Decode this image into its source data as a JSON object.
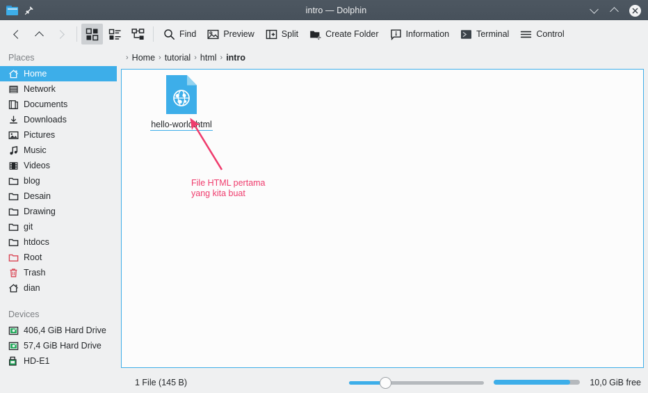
{
  "window": {
    "title": "intro — Dolphin",
    "folder_icon": "folder-icon",
    "pin_icon": "pin-icon",
    "minimize_icon": "chevron-down-icon",
    "maximize_icon": "chevron-up-icon",
    "close_icon": "close-icon"
  },
  "toolbar": {
    "back_icon": "back-arrow-icon",
    "up_icon": "up-arrow-icon",
    "forward_icon": "forward-arrow-icon",
    "view_icons_label": "icons-view",
    "view_details_label": "details-view",
    "view_tree_label": "tree-view",
    "items": [
      {
        "label": "Find",
        "icon": "search-icon"
      },
      {
        "label": "Preview",
        "icon": "image-icon"
      },
      {
        "label": "Split",
        "icon": "split-icon"
      },
      {
        "label": "Create Folder",
        "icon": "new-folder-icon"
      },
      {
        "label": "Information",
        "icon": "information-icon"
      },
      {
        "label": "Terminal",
        "icon": "terminal-icon"
      },
      {
        "label": "Control",
        "icon": "hamburger-icon"
      }
    ]
  },
  "breadcrumb": {
    "separator": "›",
    "items": [
      {
        "label": "Home",
        "current": false
      },
      {
        "label": "tutorial",
        "current": false
      },
      {
        "label": "html",
        "current": false
      },
      {
        "label": "intro",
        "current": true
      }
    ]
  },
  "sidebar": {
    "places_header": "Places",
    "devices_header": "Devices",
    "places": [
      {
        "label": "Home",
        "icon": "home-icon",
        "selected": true
      },
      {
        "label": "Network",
        "icon": "network-icon",
        "selected": false
      },
      {
        "label": "Documents",
        "icon": "documents-icon",
        "selected": false
      },
      {
        "label": "Downloads",
        "icon": "downloads-icon",
        "selected": false
      },
      {
        "label": "Pictures",
        "icon": "pictures-icon",
        "selected": false
      },
      {
        "label": "Music",
        "icon": "music-icon",
        "selected": false
      },
      {
        "label": "Videos",
        "icon": "videos-icon",
        "selected": false
      },
      {
        "label": "blog",
        "icon": "folder-icon",
        "selected": false
      },
      {
        "label": "Desain",
        "icon": "folder-icon",
        "selected": false
      },
      {
        "label": "Drawing",
        "icon": "folder-icon",
        "selected": false
      },
      {
        "label": "git",
        "icon": "folder-icon",
        "selected": false
      },
      {
        "label": "htdocs",
        "icon": "folder-icon",
        "selected": false
      },
      {
        "label": "Root",
        "icon": "root-folder-icon",
        "selected": false
      },
      {
        "label": "Trash",
        "icon": "trash-icon",
        "selected": false
      },
      {
        "label": "dian",
        "icon": "home-icon",
        "selected": false
      }
    ],
    "devices": [
      {
        "label": "406,4 GiB Hard Drive",
        "icon": "hard-drive-icon"
      },
      {
        "label": "57,4 GiB Hard Drive",
        "icon": "hard-drive-icon"
      },
      {
        "label": "HD-E1",
        "icon": "usb-drive-icon"
      }
    ]
  },
  "view": {
    "files": [
      {
        "name": "hello-world.html",
        "icon": "html-file-icon"
      }
    ],
    "annotation": {
      "text": "File HTML pertama\nyang kita buat",
      "color": "#ef3c6d",
      "arrow_icon": "arrow-icon"
    }
  },
  "statusbar": {
    "status_text": "1 File (145 B)",
    "free_space_text": "10,0 GiB free",
    "zoom_value": 25,
    "free_space_fill": 88
  },
  "colors": {
    "accent": "#3daee9",
    "titlebar": "#4a545e",
    "panel": "#eff0f1",
    "view_bg": "#fcfcfc",
    "annotation": "#ef3c6d"
  }
}
